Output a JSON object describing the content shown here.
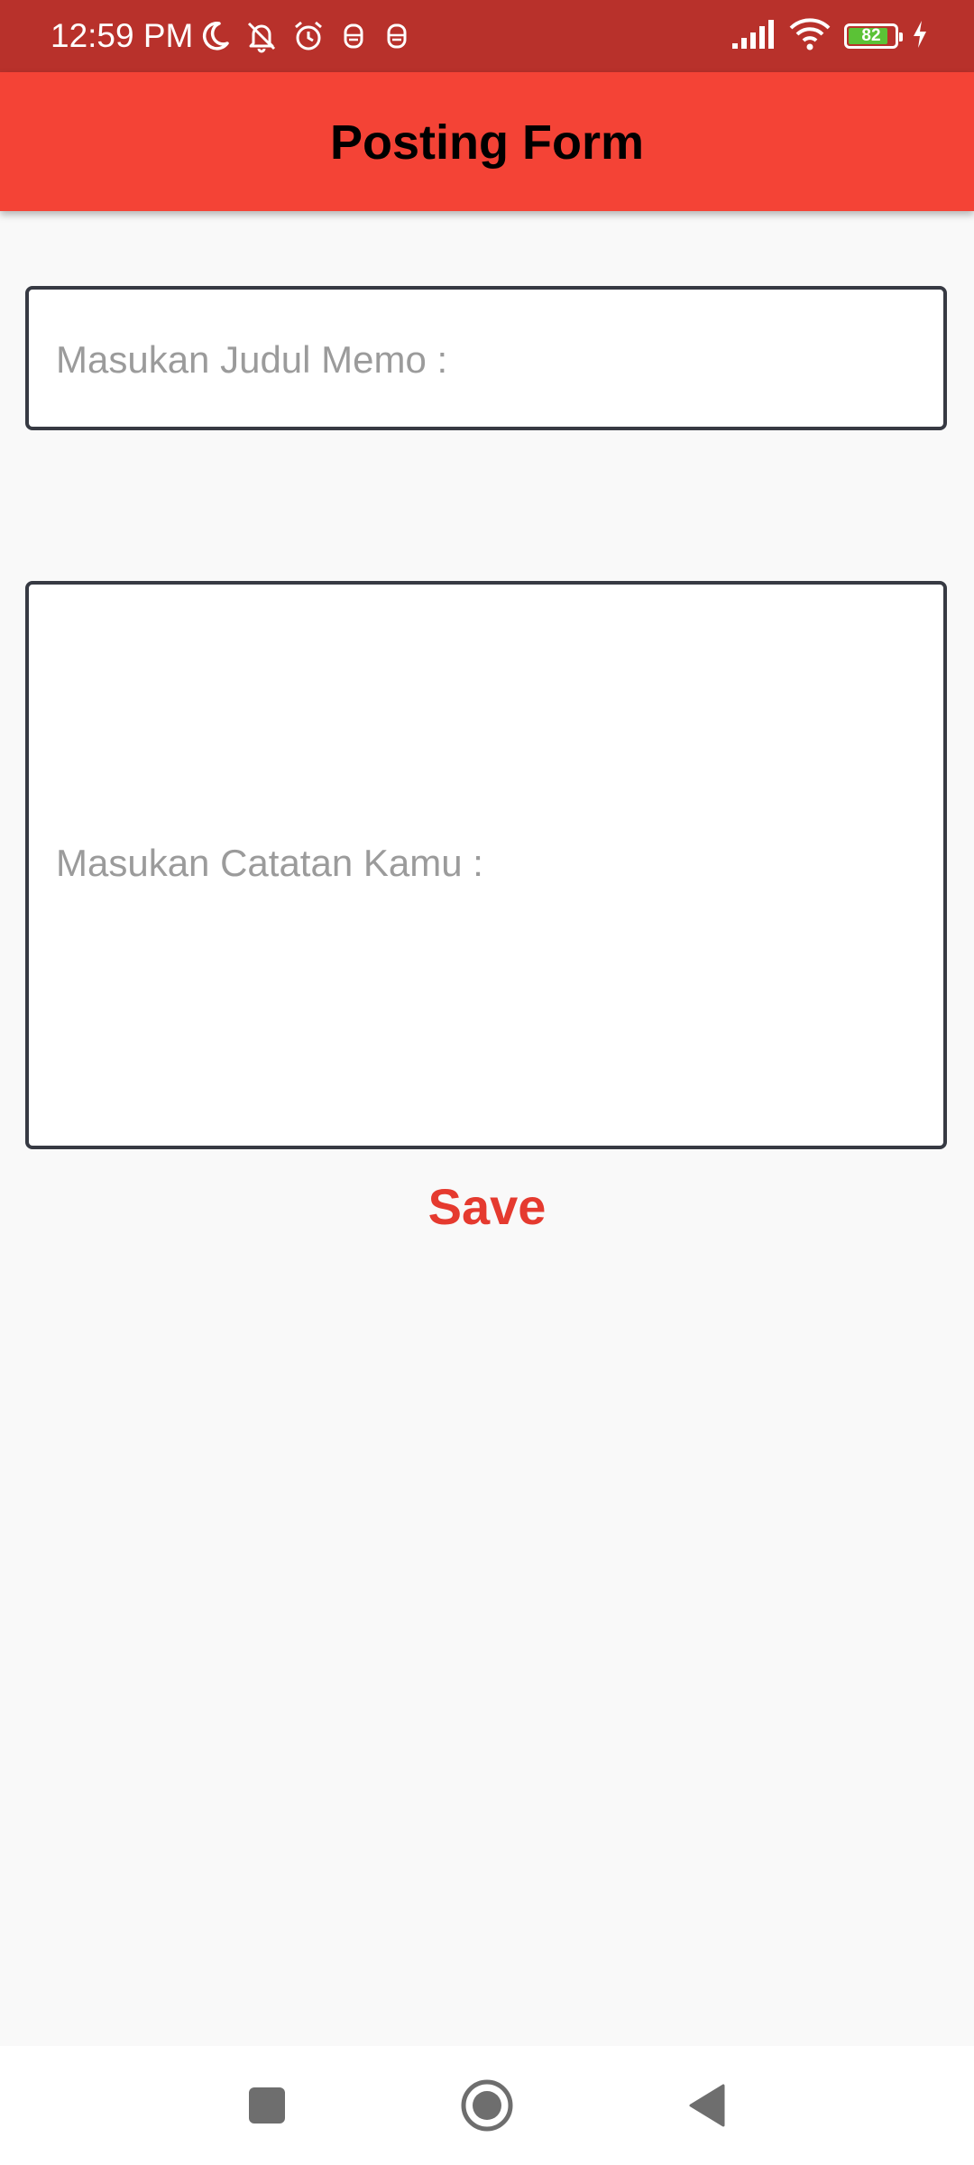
{
  "status_bar": {
    "time": "12:59 PM",
    "battery_level": "82",
    "icons_left": [
      "moon-icon",
      "bell-off-icon",
      "alarm-icon",
      "notification-icon",
      "notification-icon"
    ],
    "icons_right": [
      "signal-icon",
      "wifi-icon",
      "battery-icon",
      "charging-icon"
    ],
    "background_color": "#b8312b"
  },
  "app_bar": {
    "title": "Posting Form",
    "background_color": "#f44336"
  },
  "form": {
    "title_field": {
      "placeholder": "Masukan Judul Memo :",
      "value": ""
    },
    "notes_field": {
      "placeholder": "Masukan Catatan Kamu :",
      "value": ""
    },
    "save_label": "Save",
    "save_color": "#e53a2f"
  },
  "nav_bar": {
    "buttons": [
      "recents-button",
      "home-button",
      "back-button"
    ]
  }
}
